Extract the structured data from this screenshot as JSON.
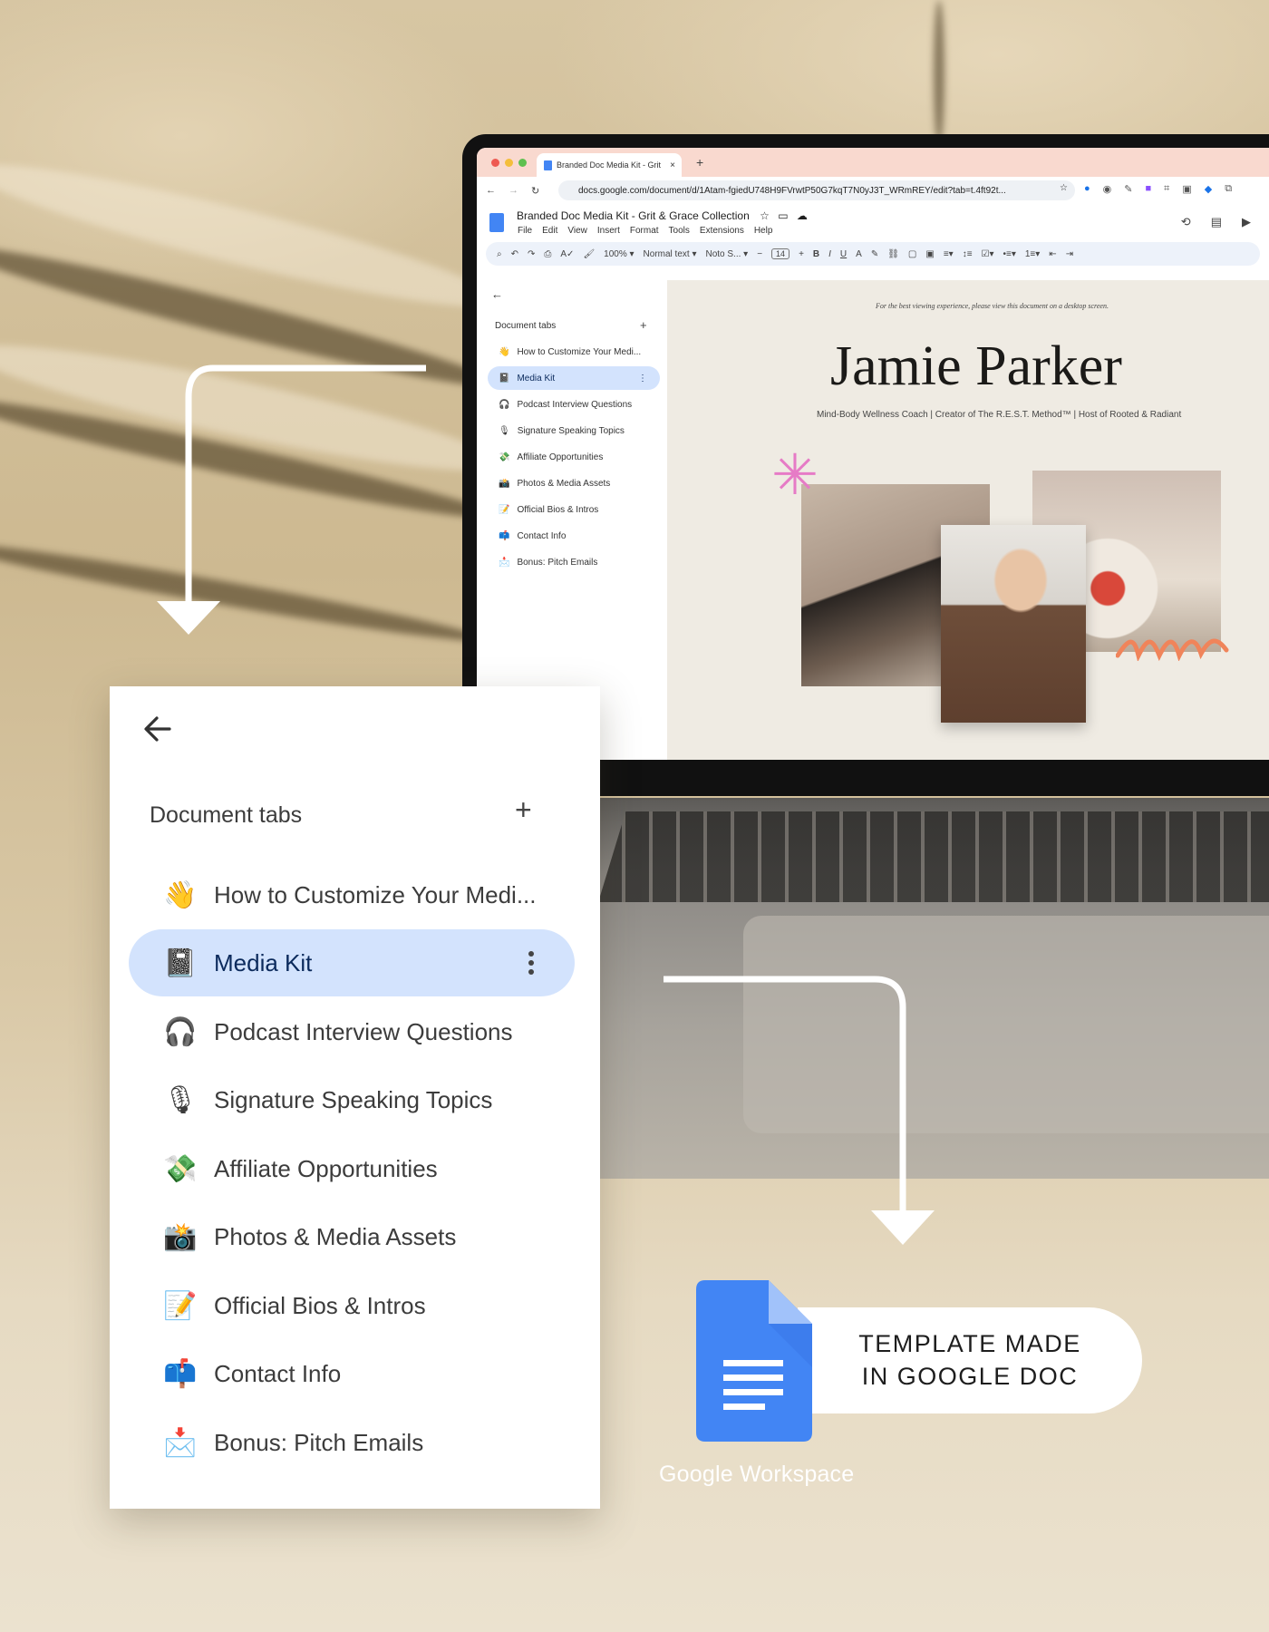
{
  "browser": {
    "tab_title": "Branded Doc Media Kit - Grit",
    "tab_close": "×",
    "new_tab": "+",
    "url": "docs.google.com/document/d/1Atam-fgiedU748H9FVrwtP50G7kqT7N0yJ3T_WRmREY/edit?tab=t.4ft92t..."
  },
  "docs": {
    "title": "Branded Doc Media Kit - Grit & Grace Collection",
    "menu": [
      "File",
      "Edit",
      "View",
      "Insert",
      "Format",
      "Tools",
      "Extensions",
      "Help"
    ],
    "toolbar": {
      "zoom": "100%",
      "style": "Normal text",
      "font": "Noto S...",
      "font_size": "14"
    }
  },
  "document_tabs": {
    "heading": "Document tabs",
    "add": "+",
    "items": [
      {
        "emoji": "👋",
        "label": "How to Customize Your Medi..."
      },
      {
        "emoji": "📓",
        "label": "Media Kit",
        "active": true
      },
      {
        "emoji": "🎧",
        "label": "Podcast Interview Questions"
      },
      {
        "emoji": "🎙",
        "label": "Signature Speaking Topics"
      },
      {
        "emoji": "💸",
        "label": "Affiliate Opportunities"
      },
      {
        "emoji": "📸",
        "label": "Photos & Media Assets"
      },
      {
        "emoji": "📝",
        "label": "Official Bios & Intros"
      },
      {
        "emoji": "📫",
        "label": "Contact Info"
      },
      {
        "emoji": "📩",
        "label": "Bonus: Pitch Emails"
      }
    ]
  },
  "doc_page": {
    "note": "For the best viewing experience, please view this document on a desktop screen.",
    "name": "Jamie Parker",
    "subtitle": "Mind-Body Wellness Coach | Creator of The R.E.S.T. Method™ | Host of Rooted & Radiant"
  },
  "badge": {
    "line1": "TEMPLATE MADE",
    "line2": "IN GOOGLE DOC",
    "workspace": "Google Workspace"
  },
  "colors": {
    "active_tab_bg": "#d3e3fd",
    "docs_blue": "#4285f4",
    "accent_pink": "#e67bc6",
    "accent_orange": "#f0845a"
  }
}
